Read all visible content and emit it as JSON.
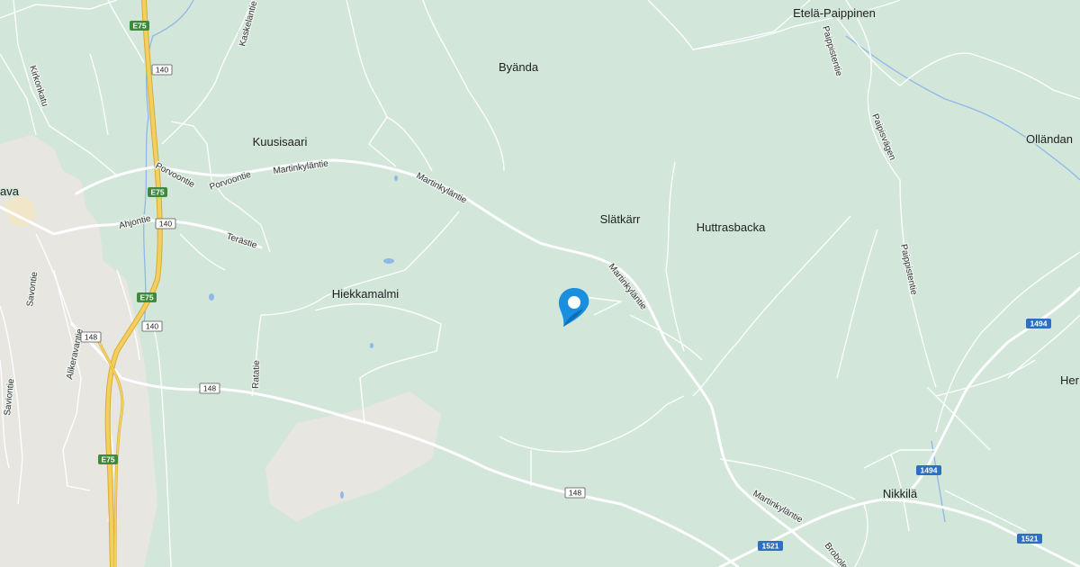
{
  "map": {
    "colors": {
      "land": "#d2e6da",
      "urban": "#e8e6e1",
      "road": "#ffffff",
      "motorway": "#f3cf5f",
      "motorway_edge": "#d9ac34",
      "water": "#8fb8e8",
      "shield_blue": "#2f6fbf",
      "shield_green": "#3e8a3e",
      "pin": "#1a8fe0"
    },
    "places": {
      "etela_paippinen": "Etelä-Paippinen",
      "byanda": "Byända",
      "kuusisaari": "Kuusisaari",
      "ollandan": "Olländan",
      "slatkarr": "Slätkärr",
      "huttrasbacka": "Huttrasbacka",
      "hiekkamalmi": "Hiekkamalmi",
      "nikkila": "Nikkilä",
      "her": "Her",
      "ava": "ava"
    },
    "roads": {
      "kaskelantie": "Kaskelantie",
      "kirkkokatu": "Kirkonkatu",
      "porvoontie_1": "Porvoontie",
      "porvoontie_2": "Porvoontie",
      "martinkylantie_1": "Martinkyläntie",
      "martinkylantie_2": "Martinkyläntie",
      "martinkylantie_3": "Martinkyläntie",
      "martinkylantie_4": "Martinkyläntie",
      "ahjontie": "Ahjontie",
      "terastie": "Terästie",
      "savontie": "Savontie",
      "alikeravantie": "Alikeravantie",
      "raatie": "Ratatie",
      "saviontie": "Saviontie",
      "paippistentie_1": "Paippistentie",
      "paippistentie_2": "Paippistentie",
      "paipisvagen": "Paipisvägen",
      "broboletie": "Brobole"
    },
    "shields": {
      "e75_a": "E75",
      "e75_b": "E75",
      "e75_c": "E75",
      "e75_d": "E75",
      "r140_a": "140",
      "r140_b": "140",
      "r140_c": "140",
      "r148_a": "148",
      "r148_b": "148",
      "r148_c": "148",
      "r1494_a": "1494",
      "r1494_b": "1494",
      "r1521_a": "1521",
      "r1521_b": "1521"
    },
    "pin": {
      "icon": "location-pin-icon"
    }
  }
}
